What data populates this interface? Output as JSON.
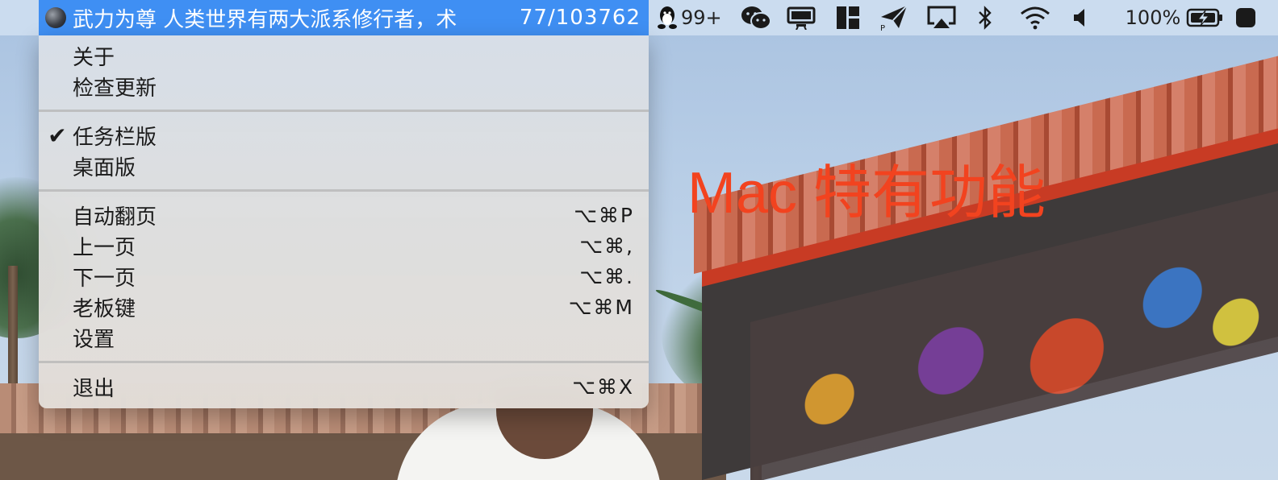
{
  "menubar": {
    "app_icon": "hat-icon",
    "app_title": "武力为尊  人类世界有两大派系修行者，术",
    "app_progress": "77/103762",
    "qq_icon": "qq-penguin-icon",
    "qq_badge": "99+",
    "wechat_icon": "wechat-icon",
    "display_icon": "display-icon",
    "layout_icon": "window-layout-icon",
    "send_icon": "paper-plane-icon",
    "airplay_icon": "airplay-icon",
    "bluetooth_icon": "bluetooth-icon",
    "wifi_icon": "wifi-icon",
    "volume_icon": "volume-icon",
    "battery_percent": "100%",
    "battery_icon": "battery-charging-icon"
  },
  "menu": {
    "groups": [
      [
        {
          "label": "关于",
          "checked": false,
          "shortcut": ""
        },
        {
          "label": "检查更新",
          "checked": false,
          "shortcut": ""
        }
      ],
      [
        {
          "label": "任务栏版",
          "checked": true,
          "shortcut": ""
        },
        {
          "label": "桌面版",
          "checked": false,
          "shortcut": ""
        }
      ],
      [
        {
          "label": "自动翻页",
          "checked": false,
          "shortcut": "⌥⌘P"
        },
        {
          "label": "上一页",
          "checked": false,
          "shortcut": "⌥⌘,"
        },
        {
          "label": "下一页",
          "checked": false,
          "shortcut": "⌥⌘."
        },
        {
          "label": "老板键",
          "checked": false,
          "shortcut": "⌥⌘M"
        },
        {
          "label": "设置",
          "checked": false,
          "shortcut": ""
        }
      ],
      [
        {
          "label": "退出",
          "checked": false,
          "shortcut": "⌥⌘X"
        }
      ]
    ],
    "check_mark": "✔"
  },
  "overlay": {
    "feature_text": "Mac 特有功能"
  },
  "colors": {
    "menubar_highlight": "#3f8ff3",
    "overlay_text": "#f2431f"
  }
}
